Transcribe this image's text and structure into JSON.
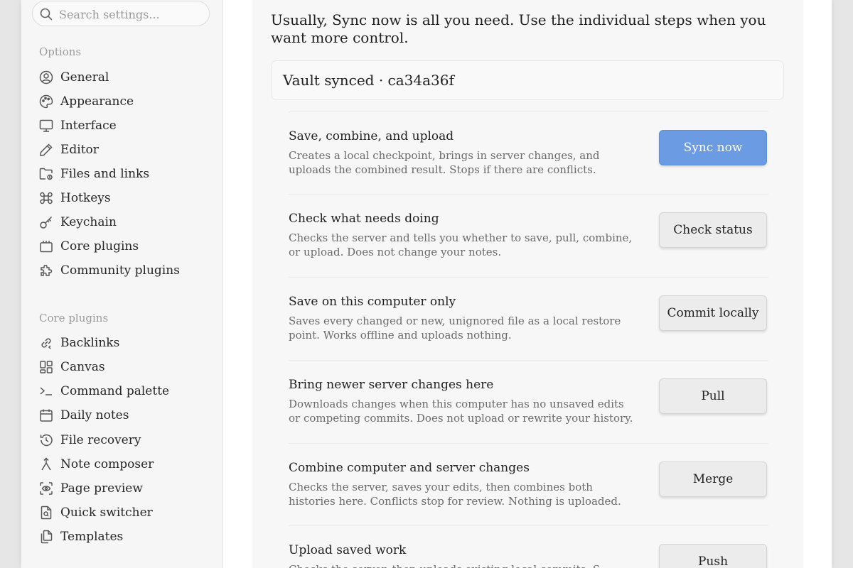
{
  "search": {
    "placeholder": "Search settings..."
  },
  "sidebar": {
    "options_label": "Options",
    "options": [
      {
        "label": "General",
        "icon": "user-circle-icon"
      },
      {
        "label": "Appearance",
        "icon": "palette-icon"
      },
      {
        "label": "Interface",
        "icon": "monitor-icon"
      },
      {
        "label": "Editor",
        "icon": "pencil-icon"
      },
      {
        "label": "Files and links",
        "icon": "folder-link-icon"
      },
      {
        "label": "Hotkeys",
        "icon": "command-icon"
      },
      {
        "label": "Keychain",
        "icon": "key-icon"
      },
      {
        "label": "Core plugins",
        "icon": "plugin-box-icon"
      },
      {
        "label": "Community plugins",
        "icon": "puzzle-icon"
      }
    ],
    "core_label": "Core plugins",
    "core": [
      {
        "label": "Backlinks",
        "icon": "backlink-icon"
      },
      {
        "label": "Canvas",
        "icon": "layout-grid-icon"
      },
      {
        "label": "Command palette",
        "icon": "terminal-icon"
      },
      {
        "label": "Daily notes",
        "icon": "calendar-icon"
      },
      {
        "label": "File recovery",
        "icon": "history-icon"
      },
      {
        "label": "Note composer",
        "icon": "merge-arrow-icon"
      },
      {
        "label": "Page preview",
        "icon": "scan-eye-icon"
      },
      {
        "label": "Quick switcher",
        "icon": "file-search-icon"
      },
      {
        "label": "Templates",
        "icon": "files-icon"
      }
    ]
  },
  "main": {
    "intro": "Usually, Sync now is all you need. Use the individual steps when you want more control.",
    "status": "Vault synced · ca34a36f",
    "rows": [
      {
        "title": "Save, combine, and upload",
        "desc": "Creates a local checkpoint, brings in server changes, and uploads the combined result. Stops if there are conflicts.",
        "button": "Sync now"
      },
      {
        "title": "Check what needs doing",
        "desc": "Checks the server and tells you whether to save, pull, combine, or upload. Does not change your notes.",
        "button": "Check status"
      },
      {
        "title": "Save on this computer only",
        "desc": "Saves every changed or new, unignored file as a local restore point. Works offline and uploads nothing.",
        "button": "Commit locally"
      },
      {
        "title": "Bring newer server changes here",
        "desc": "Downloads changes when this computer has no unsaved edits or competing commits. Does not upload or rewrite your history.",
        "button": "Pull"
      },
      {
        "title": "Combine computer and server changes",
        "desc": "Checks the server, saves your edits, then combines both histories here. Conflicts stop for review. Nothing is uploaded.",
        "button": "Merge"
      },
      {
        "title": "Upload saved work",
        "desc": "Checks the server, then uploads existing local commits. S",
        "button": "Push"
      }
    ]
  },
  "colors": {
    "accent": "#6a9be3",
    "sidebar_bg": "#f6f6f6",
    "main_bg": "#f7f7f7"
  }
}
